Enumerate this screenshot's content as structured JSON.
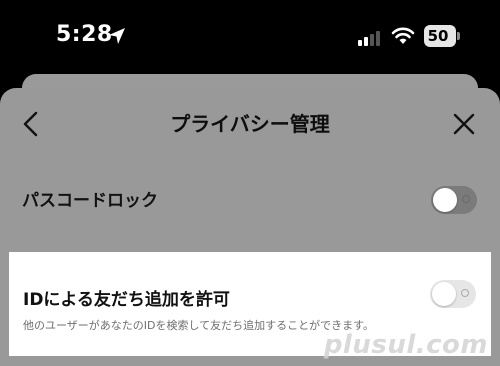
{
  "status_bar": {
    "time": "5:28",
    "battery": "50",
    "icons": [
      "location-arrow-icon",
      "cellular-signal-icon",
      "wifi-icon",
      "battery-icon"
    ]
  },
  "nav": {
    "title": "プライバシー管理",
    "back_icon": "chevron-left-icon",
    "close_icon": "close-icon"
  },
  "settings": {
    "passcode_lock": {
      "label": "パスコードロック",
      "enabled": false
    },
    "allow_add_by_id": {
      "label": "IDによる友だち追加を許可",
      "description": "他のユーザーがあなたのIDを検索して友だち追加することができます。",
      "enabled": false
    }
  },
  "watermark": "plusul.com",
  "colors": {
    "overlay_sheet": "#999999",
    "highlight_card": "#ffffff",
    "toggle_off": "#e6e6e6"
  }
}
